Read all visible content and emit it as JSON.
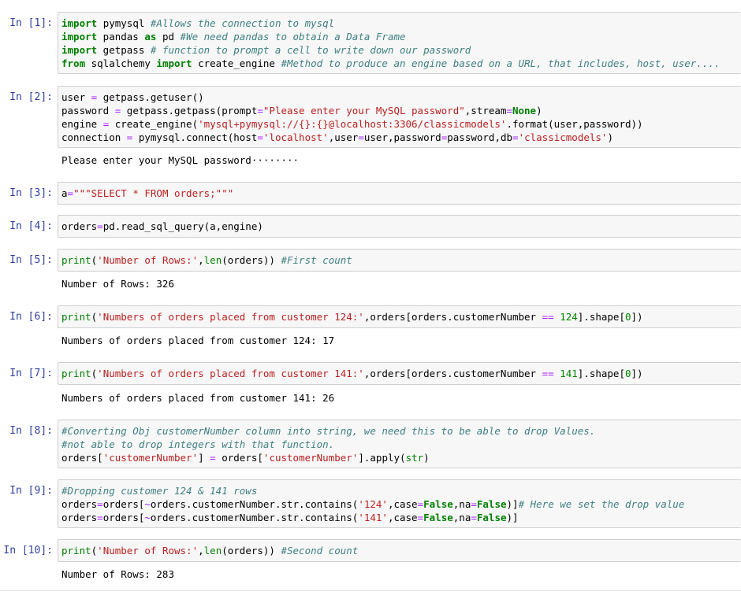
{
  "cells": [
    {
      "prompt": "In [1]:",
      "lines": [
        "import pymysql #Allows the connection to mysql",
        "import pandas as pd #We need pandas to obtain a Data Frame",
        "import getpass # function to prompt a cell to write down our password",
        "from sqlalchemy import create_engine #Method to produce an engine based on a URL, that includes, host, user...."
      ],
      "output": ""
    },
    {
      "prompt": "In [2]:",
      "lines": [
        "user = getpass.getuser()",
        "password = getpass.getpass(prompt=\"Please enter your MySQL password\",stream=None)",
        "engine = create_engine('mysql+pymysql://{}:{}@localhost:3306/classicmodels'.format(user,password))",
        "connection = pymysql.connect(host='localhost',user=user,password=password,db='classicmodels')"
      ],
      "output": "Please enter your MySQL password········"
    },
    {
      "prompt": "In [3]:",
      "lines": [
        "a=\"\"\"SELECT * FROM orders;\"\"\""
      ],
      "output": ""
    },
    {
      "prompt": "In [4]:",
      "lines": [
        "orders=pd.read_sql_query(a,engine)"
      ],
      "output": ""
    },
    {
      "prompt": "In [5]:",
      "lines": [
        "print('Number of Rows:',len(orders)) #First count"
      ],
      "output": "Number of Rows: 326"
    },
    {
      "prompt": "In [6]:",
      "lines": [
        "print('Numbers of orders placed from customer 124:',orders[orders.customerNumber == 124].shape[0])"
      ],
      "output": "Numbers of orders placed from customer 124: 17"
    },
    {
      "prompt": "In [7]:",
      "lines": [
        "print('Numbers of orders placed from customer 141:',orders[orders.customerNumber == 141].shape[0])"
      ],
      "output": "Numbers of orders placed from customer 141: 26"
    },
    {
      "prompt": "In [8]:",
      "lines": [
        "#Converting Obj customerNumber column into string, we need this to be able to drop Values.",
        "#not able to drop integers with that function.",
        "orders['customerNumber'] = orders['customerNumber'].apply(str)"
      ],
      "output": ""
    },
    {
      "prompt": "In [9]:",
      "lines": [
        "#Dropping customer 124 & 141 rows",
        "orders=orders[~orders.customerNumber.str.contains('124',case=False,na=False)]# Here we set the drop value",
        "orders=orders[~orders.customerNumber.str.contains('141',case=False,na=False)]"
      ],
      "output": ""
    },
    {
      "prompt": "In [10]:",
      "lines": [
        "print('Number of Rows:',len(orders)) #Second count"
      ],
      "output": "Number of Rows: 283"
    }
  ]
}
